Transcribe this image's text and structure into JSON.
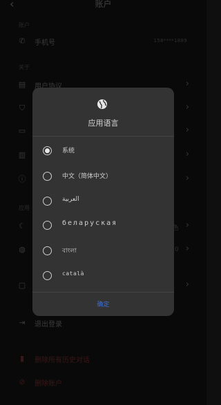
{
  "header": {
    "title": "账户",
    "back_icon": "back-arrow-icon"
  },
  "sections": {
    "account": "账户",
    "about": "关于",
    "app": "应用"
  },
  "rows": {
    "phone": {
      "label": "手机号",
      "value": "158****1889",
      "icon": "phone-icon"
    },
    "about_items": [
      {
        "label": "用户协议",
        "icon": "document-icon"
      },
      {
        "label": "",
        "icon": "shield-icon"
      },
      {
        "label": "",
        "icon": "folder-icon"
      },
      {
        "label": "",
        "icon": "clipboard-icon"
      },
      {
        "label": "",
        "icon": "info-icon"
      }
    ],
    "app_items": [
      {
        "label": "",
        "value": "色",
        "icon": "moon-icon"
      },
      {
        "label": "",
        "value": "0",
        "icon": "globe-icon"
      },
      {
        "label": "",
        "icon": "feedback-icon"
      }
    ],
    "logout": {
      "label": "退出登录",
      "icon": "logout-icon"
    },
    "delete_history": {
      "label": "删除所有历史对话",
      "icon": "trash-icon"
    },
    "delete_account": {
      "label": "删除账户",
      "icon": "block-icon"
    }
  },
  "dialog": {
    "icon": "globe-icon",
    "title": "应用语言",
    "selected_index": 0,
    "options": [
      {
        "label": "系统"
      },
      {
        "label": "中文（简体中文）"
      },
      {
        "label": "العربية"
      },
      {
        "label": "беларуская"
      },
      {
        "label": "বাংলা"
      },
      {
        "label": "català"
      }
    ],
    "confirm_label": "确定"
  },
  "colors": {
    "accent": "#3d6fd0",
    "dialog_bg": "#333333",
    "page_bg": "#0f0f0f",
    "danger": "#5a2323"
  }
}
